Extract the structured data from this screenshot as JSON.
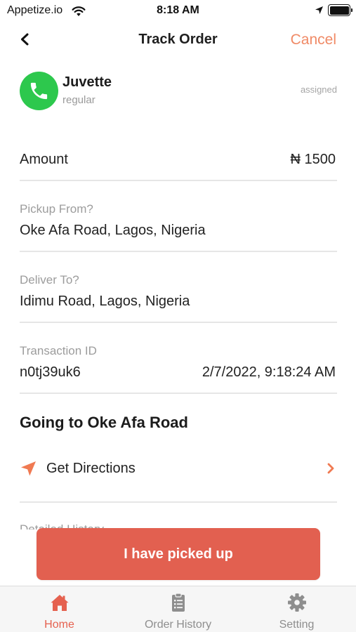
{
  "status_bar": {
    "carrier": "Appetize.io",
    "time": "8:18 AM"
  },
  "nav": {
    "title": "Track Order",
    "cancel_label": "Cancel"
  },
  "driver": {
    "name": "Juvette",
    "type": "regular",
    "status": "assigned"
  },
  "amount": {
    "label": "Amount",
    "value": "₦ 1500"
  },
  "pickup": {
    "label": "Pickup From?",
    "value": "Oke Afa Road, Lagos, Nigeria"
  },
  "deliver": {
    "label": "Deliver To?",
    "value": "Idimu Road, Lagos, Nigeria"
  },
  "transaction": {
    "label": "Transaction ID",
    "id": "n0tj39uk6",
    "date": "2/7/2022, 9:18:24 AM"
  },
  "going_to": "Going to Oke Afa Road",
  "directions_label": "Get Directions",
  "history_label": "Detailed History",
  "action_button": "I have picked up",
  "tabs": [
    {
      "label": "Home",
      "icon": "home-icon",
      "active": true
    },
    {
      "label": "Order History",
      "icon": "clipboard-icon",
      "active": false
    },
    {
      "label": "Setting",
      "icon": "gear-icon",
      "active": false
    }
  ],
  "colors": {
    "accent": "#e26050",
    "cancel": "#f08a66",
    "call_green": "#2dc84d"
  }
}
